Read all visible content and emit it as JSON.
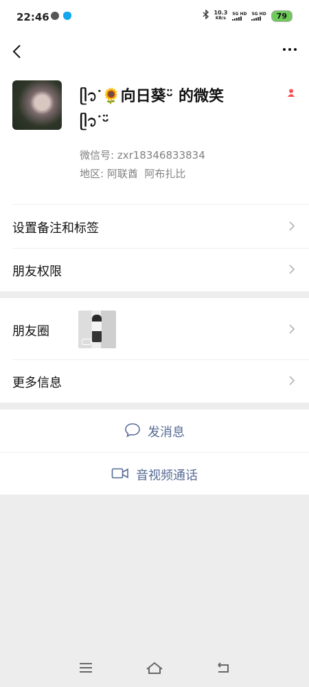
{
  "status": {
    "time": "22:46",
    "net_speed_value": "10.3",
    "net_speed_unit": "KB/s",
    "sim1": "5G HD",
    "sim2": "5G HD",
    "battery": "79",
    "app_icons": [
      "wechat-icon",
      "qq-icon"
    ],
    "bluetooth_icon": "bluetooth-icon"
  },
  "topbar": {
    "back_icon": "back-chevron-icon",
    "more_icon": "more-dots-icon"
  },
  "profile": {
    "nickname_line1": "ᥫ᭡ᐝ🌻向日葵ᵕ̈ 的微笑",
    "nickname_line2": "ᥫ᭡ᐝᵕ̈",
    "wechat_id_label": "微信号:",
    "wechat_id": "zxr18346833834",
    "region_label": "地区:",
    "region_value": "阿联酋  阿布扎比",
    "gender_icon": "female-icon",
    "gender_color": "#fa5151"
  },
  "menu": {
    "remarks": "设置备注和标签",
    "permissions": "朋友权限",
    "moments": "朋友圈",
    "more_info": "更多信息"
  },
  "actions": {
    "message": "发消息",
    "av_call": "音视频通话",
    "accent": "#576b95"
  },
  "navbar": {
    "menu_icon": "menu-icon",
    "home_icon": "home-icon",
    "back_icon": "back-icon"
  }
}
